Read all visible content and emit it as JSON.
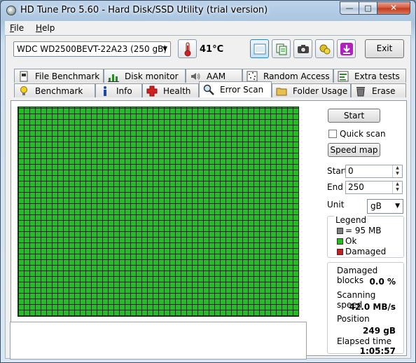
{
  "window": {
    "title": "HD Tune Pro 5.60 - Hard Disk/SSD Utility (trial version)",
    "controls": {
      "minimize": "—",
      "maximize": "□",
      "close": "✕"
    }
  },
  "menu": {
    "items": [
      {
        "accel": "F",
        "rest": "ile"
      },
      {
        "accel": "H",
        "rest": "elp"
      }
    ]
  },
  "toolbar": {
    "drive": "WDC WD2500BEVT-22A23 (250 gB)",
    "temperature": "41°C",
    "exit_label": "Exit",
    "icons": [
      "thermometer-icon",
      "screenshot-icon",
      "copy-icon",
      "camera-icon",
      "options-icon",
      "save-icon"
    ]
  },
  "tabs": {
    "top_row": [
      "File Benchmark",
      "Disk monitor",
      "AAM",
      "Random Access",
      "Extra tests"
    ],
    "bottom_row": [
      "Benchmark",
      "Info",
      "Health",
      "Error Scan",
      "Folder Usage",
      "Erase"
    ],
    "active": "Error Scan"
  },
  "error_scan": {
    "start_button": "Start",
    "quick_scan_label": "Quick scan",
    "quick_scan_checked": false,
    "speed_map_button": "Speed map",
    "start_label": "Start",
    "start_value": "0",
    "end_label": "End",
    "end_value": "250",
    "unit_label": "Unit",
    "unit_value": "gB",
    "legend": {
      "title": "Legend",
      "block_size": "= 95 MB",
      "ok": "Ok",
      "damaged": "Damaged"
    },
    "colors": {
      "ok": "#20c020",
      "damaged": "#c02020",
      "block": "#808080"
    },
    "stats": {
      "damaged_blocks_label": "Damaged blocks",
      "damaged_blocks_value": "0.0 %",
      "scanning_speed_label": "Scanning speed",
      "scanning_speed_value": "42.0 MB/s",
      "position_label": "Position",
      "position_value": "249 gB",
      "elapsed_label": "Elapsed time",
      "elapsed_value": "1:05:57"
    },
    "log_text": ""
  }
}
